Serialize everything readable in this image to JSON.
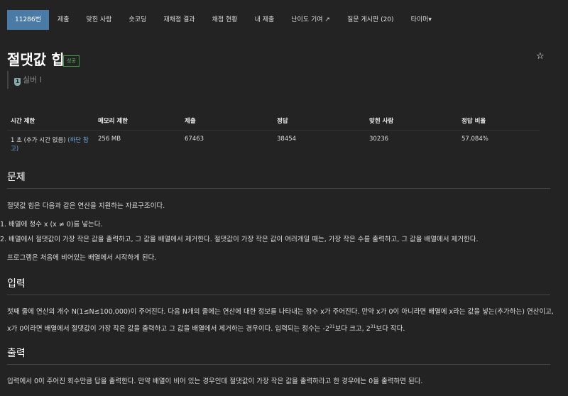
{
  "nav": {
    "items": [
      "11286번",
      "제출",
      "맞힌 사람",
      "숏코딩",
      "재채점 결과",
      "채점 현황",
      "내 제출",
      "난이도 기여",
      "질문 게시판 (20)",
      "타이머"
    ]
  },
  "problem": {
    "title": "절댓값 힙",
    "badge": "성공",
    "tier": "실버 I",
    "tier_num": "1"
  },
  "table": {
    "headers": [
      "시간 제한",
      "메모리 제한",
      "제출",
      "정답",
      "맞힌 사람",
      "정답 비율"
    ],
    "time": "1 초 (추가 시간 없음) ",
    "time_link": "(하단 참고)",
    "memory": "256 MB",
    "submissions": "67463",
    "accepted": "38454",
    "solvers": "30236",
    "ratio": "57.084%"
  },
  "sections": {
    "problem_title": "문제",
    "problem_intro": "절댓값 힙은 다음과 같은 연산을 지원하는 자료구조이다.",
    "problem_items": [
      "1. 배열에 정수 x (x ≠ 0)를 넣는다.",
      "2. 배열에서 절댓값이 가장 작은 값을 출력하고, 그 값을 배열에서 제거한다. 절댓값이 가장 작은 값이 여러개일 때는, 가장 작은 수를 출력하고, 그 값을 배열에서 제거한다."
    ],
    "problem_outro": "프로그램은 처음에 비어있는 배열에서 시작하게 된다.",
    "input_title": "입력",
    "input_text_a": "첫째 줄에 연산의 개수 N(1≤N≤100,000)이 주어진다. 다음 N개의 줄에는 연산에 대한 정보를 나타내는 정수 x가 주어진다. 만약 x가 0이 아니라면 배열에 x라는 값을 넣는(추가하는) 연산이고, x가 0이라면 배열에서 절댓값이 가장 작은 값을 출력하고 그 값을 배열에서 제거하는 경우이다. 입력되는 정수는 -2",
    "exp": "31",
    "input_text_b": "보다 크고, 2",
    "input_text_c": "보다 작다.",
    "output_title": "출력",
    "output_text": "입력에서 0이 주어진 회수만큼 답을 출력한다. 만약 배열이 비어 있는 경우인데 절댓값이 가장 작은 값을 출력하라고 한 경우에는 0을 출력하면 된다."
  }
}
